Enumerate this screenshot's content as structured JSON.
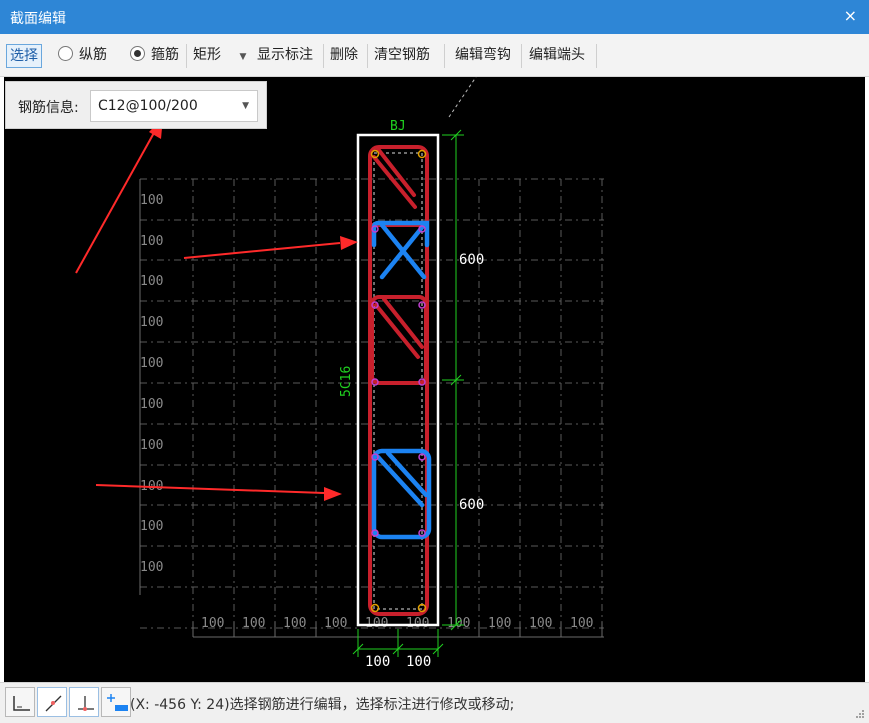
{
  "window": {
    "title": "截面编辑",
    "close_glyph": "×"
  },
  "toolbar": {
    "select_label": "选择",
    "longitudinal_label": "纵筋",
    "stirrup_label": "箍筋",
    "shape_value": "矩形",
    "show_dims_label": "显示标注",
    "delete_label": "删除",
    "clear_label": "清空钢筋",
    "edit_hook_label": "编辑弯钩",
    "edit_end_label": "编辑端头"
  },
  "rebar_info": {
    "label": "钢筋信息:",
    "value": "C12@100/200"
  },
  "drawing": {
    "top_label": "BJ",
    "side_label": "5C16",
    "grid_v_labels": [
      "100",
      "100",
      "100",
      "100",
      "100",
      "100",
      "100",
      "100",
      "100",
      "100"
    ],
    "grid_h_labels": [
      "100",
      "100",
      "100",
      "100",
      "100",
      "100",
      "100",
      "100",
      "100",
      "100"
    ],
    "dim_upper": "600",
    "dim_lower": "600",
    "dim_bottom_left": "100",
    "dim_bottom_right": "100",
    "colors": {
      "grid": "#5a5a5a",
      "section_outline": "#ffffff",
      "red_stirrup": "#c8202c",
      "blue_stirrup": "#1c83f2",
      "dimension": "#20d020",
      "annotation_arrow": "#ff2a2a"
    }
  },
  "status": {
    "coord_text": "(X: -456 Y: 24)选择钢筋进行编辑，选择标注进行修改或移动;",
    "buttons": [
      "ortho-icon",
      "polar-icon",
      "snap-icon",
      "dynamic-input-icon"
    ]
  }
}
